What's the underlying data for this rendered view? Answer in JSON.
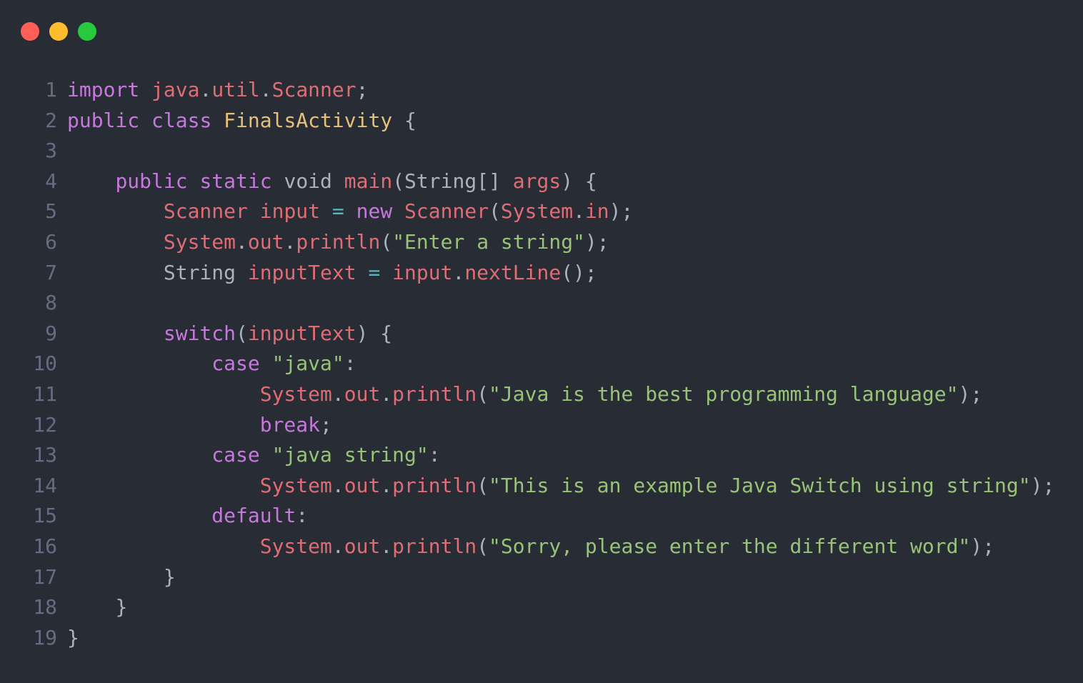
{
  "window": {
    "traffic_lights": {
      "close_color": "#ff5f56",
      "minimize_color": "#ffbd2e",
      "zoom_color": "#27c93f"
    }
  },
  "colors": {
    "background": "#282c34",
    "line_number": "#636d83",
    "keyword": "#c678dd",
    "identifier": "#e06c75",
    "type": "#e5c07b",
    "string": "#98c379",
    "operator": "#56b6c2",
    "plain": "#abb2bf"
  },
  "editor": {
    "language": "java",
    "lines": [
      {
        "num": "1",
        "tokens": [
          {
            "t": "import",
            "c": "keyword"
          },
          {
            "t": " ",
            "c": "plain"
          },
          {
            "t": "java",
            "c": "identifier"
          },
          {
            "t": ".",
            "c": "plain"
          },
          {
            "t": "util",
            "c": "identifier"
          },
          {
            "t": ".",
            "c": "plain"
          },
          {
            "t": "Scanner",
            "c": "identifier"
          },
          {
            "t": ";",
            "c": "plain"
          }
        ]
      },
      {
        "num": "2",
        "tokens": [
          {
            "t": "public",
            "c": "keyword"
          },
          {
            "t": " ",
            "c": "plain"
          },
          {
            "t": "class",
            "c": "keyword"
          },
          {
            "t": " ",
            "c": "plain"
          },
          {
            "t": "FinalsActivity",
            "c": "type"
          },
          {
            "t": " {",
            "c": "plain"
          }
        ]
      },
      {
        "num": "3",
        "tokens": []
      },
      {
        "num": "4",
        "tokens": [
          {
            "t": "    ",
            "c": "plain"
          },
          {
            "t": "public",
            "c": "keyword"
          },
          {
            "t": " ",
            "c": "plain"
          },
          {
            "t": "static",
            "c": "keyword"
          },
          {
            "t": " void ",
            "c": "plain"
          },
          {
            "t": "main",
            "c": "identifier"
          },
          {
            "t": "(String[] ",
            "c": "plain"
          },
          {
            "t": "args",
            "c": "identifier"
          },
          {
            "t": ") {",
            "c": "plain"
          }
        ]
      },
      {
        "num": "5",
        "tokens": [
          {
            "t": "        ",
            "c": "plain"
          },
          {
            "t": "Scanner",
            "c": "identifier"
          },
          {
            "t": " ",
            "c": "plain"
          },
          {
            "t": "input",
            "c": "identifier"
          },
          {
            "t": " ",
            "c": "plain"
          },
          {
            "t": "=",
            "c": "operator"
          },
          {
            "t": " ",
            "c": "plain"
          },
          {
            "t": "new",
            "c": "keyword"
          },
          {
            "t": " ",
            "c": "plain"
          },
          {
            "t": "Scanner",
            "c": "identifier"
          },
          {
            "t": "(",
            "c": "plain"
          },
          {
            "t": "System",
            "c": "identifier"
          },
          {
            "t": ".",
            "c": "plain"
          },
          {
            "t": "in",
            "c": "identifier"
          },
          {
            "t": ");",
            "c": "plain"
          }
        ]
      },
      {
        "num": "6",
        "tokens": [
          {
            "t": "        ",
            "c": "plain"
          },
          {
            "t": "System",
            "c": "identifier"
          },
          {
            "t": ".",
            "c": "plain"
          },
          {
            "t": "out",
            "c": "identifier"
          },
          {
            "t": ".",
            "c": "plain"
          },
          {
            "t": "println",
            "c": "identifier"
          },
          {
            "t": "(",
            "c": "plain"
          },
          {
            "t": "\"Enter a string\"",
            "c": "string"
          },
          {
            "t": ");",
            "c": "plain"
          }
        ]
      },
      {
        "num": "7",
        "tokens": [
          {
            "t": "        ",
            "c": "plain"
          },
          {
            "t": "String ",
            "c": "plain"
          },
          {
            "t": "inputText",
            "c": "identifier"
          },
          {
            "t": " ",
            "c": "plain"
          },
          {
            "t": "=",
            "c": "operator"
          },
          {
            "t": " ",
            "c": "plain"
          },
          {
            "t": "input",
            "c": "identifier"
          },
          {
            "t": ".",
            "c": "plain"
          },
          {
            "t": "nextLine",
            "c": "identifier"
          },
          {
            "t": "();",
            "c": "plain"
          }
        ]
      },
      {
        "num": "8",
        "tokens": []
      },
      {
        "num": "9",
        "tokens": [
          {
            "t": "        ",
            "c": "plain"
          },
          {
            "t": "switch",
            "c": "keyword"
          },
          {
            "t": "(",
            "c": "plain"
          },
          {
            "t": "inputText",
            "c": "identifier"
          },
          {
            "t": ") {",
            "c": "plain"
          }
        ]
      },
      {
        "num": "10",
        "tokens": [
          {
            "t": "            ",
            "c": "plain"
          },
          {
            "t": "case",
            "c": "keyword"
          },
          {
            "t": " ",
            "c": "plain"
          },
          {
            "t": "\"java\"",
            "c": "string"
          },
          {
            "t": ":",
            "c": "plain"
          }
        ]
      },
      {
        "num": "11",
        "tokens": [
          {
            "t": "                ",
            "c": "plain"
          },
          {
            "t": "System",
            "c": "identifier"
          },
          {
            "t": ".",
            "c": "plain"
          },
          {
            "t": "out",
            "c": "identifier"
          },
          {
            "t": ".",
            "c": "plain"
          },
          {
            "t": "println",
            "c": "identifier"
          },
          {
            "t": "(",
            "c": "plain"
          },
          {
            "t": "\"Java is the best programming language\"",
            "c": "string"
          },
          {
            "t": ");",
            "c": "plain"
          }
        ]
      },
      {
        "num": "12",
        "tokens": [
          {
            "t": "                ",
            "c": "plain"
          },
          {
            "t": "break",
            "c": "keyword"
          },
          {
            "t": ";",
            "c": "plain"
          }
        ]
      },
      {
        "num": "13",
        "tokens": [
          {
            "t": "            ",
            "c": "plain"
          },
          {
            "t": "case",
            "c": "keyword"
          },
          {
            "t": " ",
            "c": "plain"
          },
          {
            "t": "\"java string\"",
            "c": "string"
          },
          {
            "t": ":",
            "c": "plain"
          }
        ]
      },
      {
        "num": "14",
        "tokens": [
          {
            "t": "                ",
            "c": "plain"
          },
          {
            "t": "System",
            "c": "identifier"
          },
          {
            "t": ".",
            "c": "plain"
          },
          {
            "t": "out",
            "c": "identifier"
          },
          {
            "t": ".",
            "c": "plain"
          },
          {
            "t": "println",
            "c": "identifier"
          },
          {
            "t": "(",
            "c": "plain"
          },
          {
            "t": "\"This is an example Java Switch using string\"",
            "c": "string"
          },
          {
            "t": ");",
            "c": "plain"
          }
        ]
      },
      {
        "num": "15",
        "tokens": [
          {
            "t": "            ",
            "c": "plain"
          },
          {
            "t": "default",
            "c": "keyword"
          },
          {
            "t": ":",
            "c": "plain"
          }
        ]
      },
      {
        "num": "16",
        "tokens": [
          {
            "t": "                ",
            "c": "plain"
          },
          {
            "t": "System",
            "c": "identifier"
          },
          {
            "t": ".",
            "c": "plain"
          },
          {
            "t": "out",
            "c": "identifier"
          },
          {
            "t": ".",
            "c": "plain"
          },
          {
            "t": "println",
            "c": "identifier"
          },
          {
            "t": "(",
            "c": "plain"
          },
          {
            "t": "\"Sorry, please enter the different word\"",
            "c": "string"
          },
          {
            "t": ");",
            "c": "plain"
          }
        ]
      },
      {
        "num": "17",
        "tokens": [
          {
            "t": "        ",
            "c": "plain"
          },
          {
            "t": "}",
            "c": "plain"
          }
        ]
      },
      {
        "num": "18",
        "tokens": [
          {
            "t": "    ",
            "c": "plain"
          },
          {
            "t": "}",
            "c": "plain"
          }
        ]
      },
      {
        "num": "19",
        "tokens": [
          {
            "t": "}",
            "c": "plain"
          }
        ]
      }
    ]
  }
}
